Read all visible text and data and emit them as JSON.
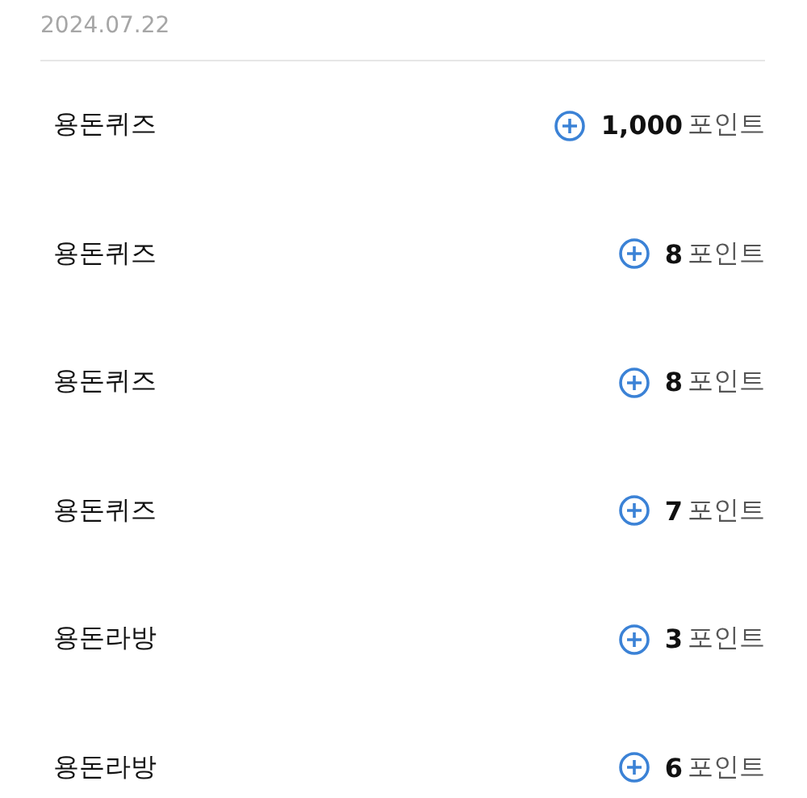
{
  "date": "2024.07.22",
  "entries": [
    {
      "title": "용돈퀴즈",
      "amount": "1,000",
      "unit": "포인트"
    },
    {
      "title": "용돈퀴즈",
      "amount": "8",
      "unit": "포인트"
    },
    {
      "title": "용돈퀴즈",
      "amount": "8",
      "unit": "포인트"
    },
    {
      "title": "용돈퀴즈",
      "amount": "7",
      "unit": "포인트"
    },
    {
      "title": "용돈라방",
      "amount": "3",
      "unit": "포인트"
    },
    {
      "title": "용돈라방",
      "amount": "6",
      "unit": "포인트"
    }
  ]
}
